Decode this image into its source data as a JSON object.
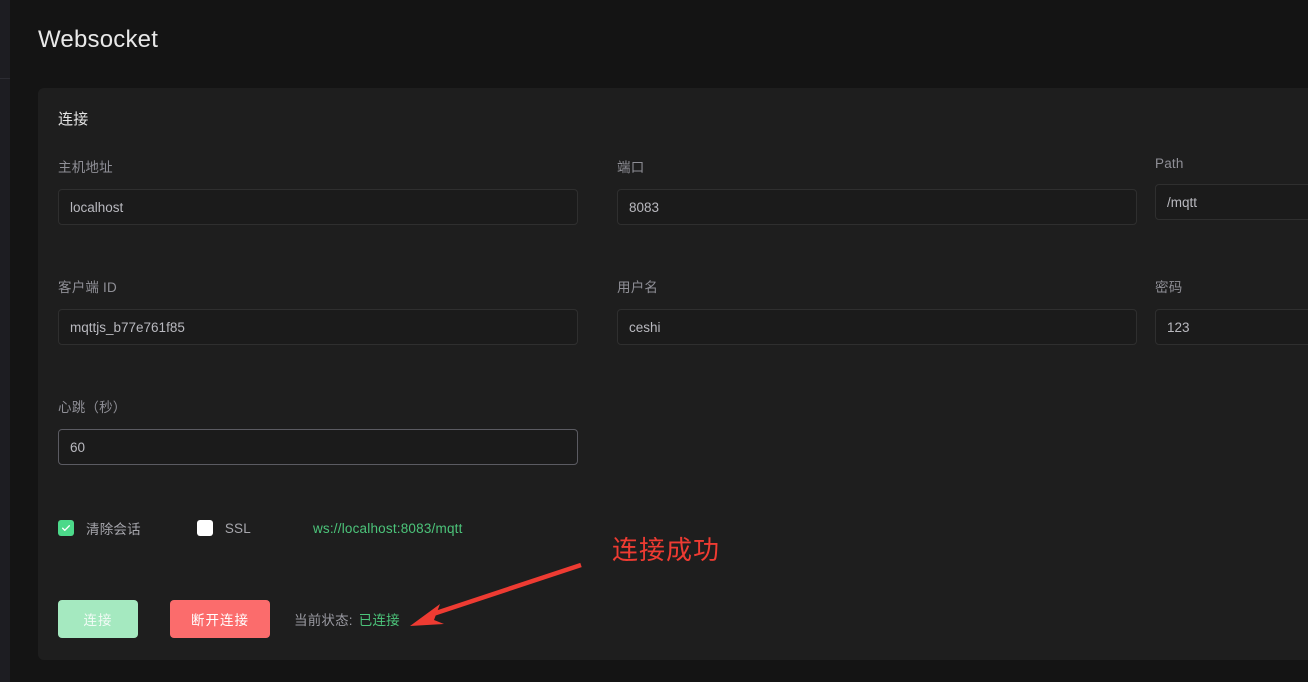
{
  "page": {
    "title": "Websocket"
  },
  "colors": {
    "accent_green": "#4cd98a",
    "url_green": "#4cc47a",
    "danger_red": "#fb6c6c",
    "annotation_red": "#ee3b32",
    "card_bg": "#1e1e1e",
    "page_bg": "#141414"
  },
  "card": {
    "title": "连接",
    "fields": [
      {
        "label": "主机地址",
        "value": "localhost",
        "name": "host-address",
        "focused": false
      },
      {
        "label": "端口",
        "value": "8083",
        "name": "port",
        "focused": false
      },
      {
        "label": "Path",
        "value": "/mqtt",
        "name": "path",
        "focused": false
      },
      {
        "label": "客户端 ID",
        "value": "mqttjs_b77e761f85",
        "name": "client-id",
        "focused": false
      },
      {
        "label": "用户名",
        "value": "ceshi",
        "name": "username",
        "focused": false
      },
      {
        "label": "密码",
        "value": "123",
        "name": "password",
        "focused": false
      },
      {
        "label": "心跳（秒）",
        "value": "60",
        "name": "keepalive",
        "focused": true
      }
    ],
    "options": {
      "clean_session": {
        "label": "清除会话",
        "checked": true
      },
      "ssl": {
        "label": "SSL",
        "checked": false
      },
      "url": "ws://localhost:8083/mqtt"
    },
    "actions": {
      "connect_label": "连接",
      "disconnect_label": "断开连接",
      "status_label": "当前状态:",
      "status_value": "已连接"
    }
  },
  "annotation": {
    "text": "连接成功",
    "icon": "arrow-down-left-icon"
  }
}
